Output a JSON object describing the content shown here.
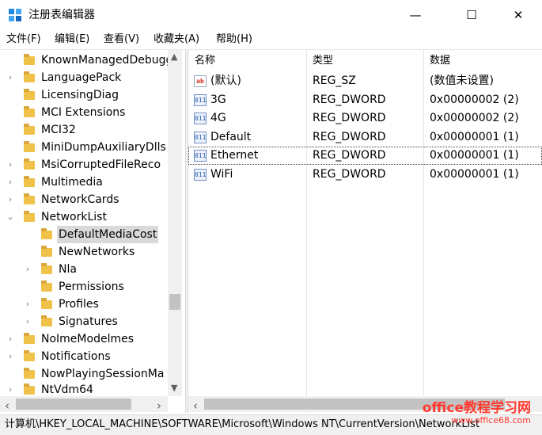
{
  "window": {
    "title": "注册表编辑器",
    "minimize": "—",
    "maximize": "☐",
    "close": "✕"
  },
  "menu": [
    "文件(F)",
    "编辑(E)",
    "查看(V)",
    "收藏夹(A)",
    "帮助(H)"
  ],
  "tree": {
    "items": [
      {
        "label": "KnownManagedDebuggi",
        "expander": ""
      },
      {
        "label": "LanguagePack",
        "expander": "›"
      },
      {
        "label": "LicensingDiag",
        "expander": ""
      },
      {
        "label": "MCI Extensions",
        "expander": ""
      },
      {
        "label": "MCI32",
        "expander": ""
      },
      {
        "label": "MiniDumpAuxiliaryDlls",
        "expander": ""
      },
      {
        "label": "MsiCorruptedFileReco",
        "expander": "›"
      },
      {
        "label": "Multimedia",
        "expander": "›"
      },
      {
        "label": "NetworkCards",
        "expander": "›"
      },
      {
        "label": "NetworkList",
        "expander": "⌄"
      },
      {
        "label": "DefaultMediaCost",
        "expander": ""
      },
      {
        "label": "NewNetworks",
        "expander": ""
      },
      {
        "label": "Nla",
        "expander": "›"
      },
      {
        "label": "Permissions",
        "expander": ""
      },
      {
        "label": "Profiles",
        "expander": "›"
      },
      {
        "label": "Signatures",
        "expander": "›"
      },
      {
        "label": "NoImeModelmes",
        "expander": "›"
      },
      {
        "label": "Notifications",
        "expander": "›"
      },
      {
        "label": "NowPlayingSessionMa",
        "expander": ""
      },
      {
        "label": "NtVdm64",
        "expander": "›"
      }
    ]
  },
  "list": {
    "columns": [
      "名称",
      "类型",
      "数据"
    ],
    "rows": [
      {
        "icon": "string-value-icon",
        "icon_text": "ab",
        "name": "(默认)",
        "type": "REG_SZ",
        "data": "(数值未设置)"
      },
      {
        "icon": "binary-value-icon",
        "icon_text": "011",
        "name": "3G",
        "type": "REG_DWORD",
        "data": "0x00000002 (2)"
      },
      {
        "icon": "binary-value-icon",
        "icon_text": "011",
        "name": "4G",
        "type": "REG_DWORD",
        "data": "0x00000002 (2)"
      },
      {
        "icon": "binary-value-icon",
        "icon_text": "011",
        "name": "Default",
        "type": "REG_DWORD",
        "data": "0x00000001 (1)"
      },
      {
        "icon": "binary-value-icon",
        "icon_text": "011",
        "name": "Ethernet",
        "type": "REG_DWORD",
        "data": "0x00000001 (1)"
      },
      {
        "icon": "binary-value-icon",
        "icon_text": "011",
        "name": "WiFi",
        "type": "REG_DWORD",
        "data": "0x00000001 (1)"
      }
    ]
  },
  "scroll": {
    "up": "▲",
    "down": "▼",
    "left": "‹",
    "right": "›"
  },
  "status": {
    "path": "计算机\\HKEY_LOCAL_MACHINE\\SOFTWARE\\Microsoft\\Windows NT\\CurrentVersion\\NetworkList"
  },
  "watermark": {
    "line1": "office教程学习网",
    "line2": "www.office68.com"
  },
  "colors": {
    "folder": "#f0c24a",
    "selection": "#d9d9d9",
    "accent": "#0078d7"
  }
}
